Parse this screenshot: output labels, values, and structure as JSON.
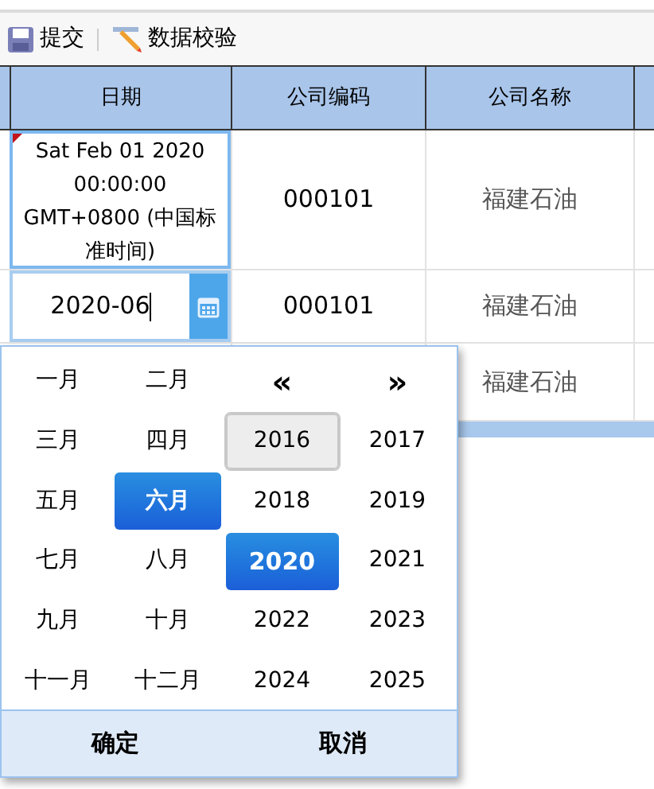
{
  "toolbar": [
    {
      "kind": "save",
      "label": "提交"
    },
    {
      "kind": "validate",
      "label": "数据校验"
    }
  ],
  "table": {
    "columns": [
      "日期",
      "公司编码",
      "公司名称"
    ],
    "rows": [
      {
        "date": "Sat Feb 01 2020 00:00:00 GMT+0800 (中国标准时间)",
        "dirty": true,
        "editing": false,
        "code": "000101",
        "name": "福建石油"
      },
      {
        "date": "2020-06",
        "dirty": false,
        "editing": true,
        "code": "000101",
        "name": "福建石油"
      },
      {
        "name": "福建石油"
      }
    ]
  },
  "picker": {
    "months": [
      {
        "label": "一月",
        "selected": false
      },
      {
        "label": "二月",
        "selected": false
      },
      {
        "label": "三月",
        "selected": false
      },
      {
        "label": "四月",
        "selected": false
      },
      {
        "label": "五月",
        "selected": false
      },
      {
        "label": "六月",
        "selected": true
      },
      {
        "label": "七月",
        "selected": false
      },
      {
        "label": "八月",
        "selected": false
      },
      {
        "label": "九月",
        "selected": false
      },
      {
        "label": "十月",
        "selected": false
      },
      {
        "label": "十一月",
        "selected": false
      },
      {
        "label": "十二月",
        "selected": false
      }
    ],
    "prev": "«",
    "next": "»",
    "years": [
      {
        "label": "2016",
        "selected": false,
        "hovered": true
      },
      {
        "label": "2017",
        "selected": false,
        "hovered": false
      },
      {
        "label": "2018",
        "selected": false,
        "hovered": false
      },
      {
        "label": "2019",
        "selected": false,
        "hovered": false
      },
      {
        "label": "2020",
        "selected": true,
        "hovered": false
      },
      {
        "label": "2021",
        "selected": false,
        "hovered": false
      },
      {
        "label": "2022",
        "selected": false,
        "hovered": false
      },
      {
        "label": "2023",
        "selected": false,
        "hovered": false
      },
      {
        "label": "2024",
        "selected": false,
        "hovered": false
      },
      {
        "label": "2025",
        "selected": false,
        "hovered": false
      }
    ],
    "buttons": [
      "确定",
      "取消"
    ]
  }
}
